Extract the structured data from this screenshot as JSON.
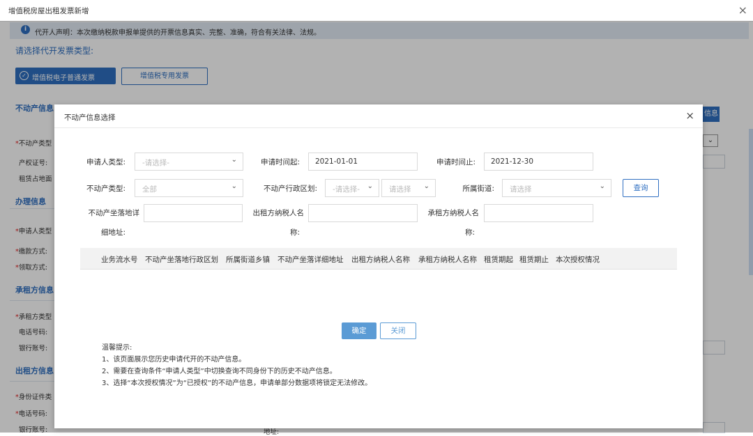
{
  "page": {
    "title": "增值税房屋出租发票新增",
    "close_symbol": "×",
    "notice_text": "代开人声明：本次缴纳税款申报单提供的开票信息真实、完整、准确，符合有关法律、法规。",
    "choose_label": "请选择代开发票类型:",
    "btn_ordinary": "增值税电子普通发票",
    "btn_special": "增值税专用发票",
    "sections": {
      "realestate": "不动产信息",
      "handling": "办理信息",
      "lessee": "承租方信息",
      "lessor": "出租方信息"
    },
    "right_btn": "信息",
    "bg_labels": {
      "estate_type": "不动产类型",
      "cert_no": "产权证号:",
      "area": "租赁占地面",
      "applicant_type": "申请人类型",
      "pay_method": "缴款方式:",
      "receive_method": "领取方式:",
      "lessee_type": "承租方类型",
      "lessee_phone": "电话号码:",
      "lessee_bank": "银行账号:",
      "id_type": "身份证件类",
      "lessor_phone": "电话号码:",
      "lessor_bank": "银行账号:",
      "address": "地址:"
    }
  },
  "dialog": {
    "title": "不动产信息选择",
    "close_symbol": "×",
    "filters": {
      "applicant_type_label": "申请人类型:",
      "applicant_type_placeholder": "-请选择-",
      "date_start_label": "申请时间起:",
      "date_start_value": "2021-01-01",
      "date_end_label": "申请时间止:",
      "date_end_value": "2021-12-30",
      "estate_type_label": "不动产类型:",
      "estate_type_placeholder": "全部",
      "admin_region_label": "不动产行政区划:",
      "admin_region_placeholder1": "-请选择-",
      "admin_region_placeholder2": "请选择",
      "street_label": "所属街道:",
      "street_placeholder": "请选择",
      "query_button": "查询",
      "address_label_l1": "不动产坐落地详",
      "address_label_l2": "细地址:",
      "lessor_name_label_l1": "出租方纳税人名",
      "lessor_name_label_l2": "称:",
      "lessee_name_label_l1": "承租方纳税人名",
      "lessee_name_label_l2": "称:"
    },
    "table_headers": [
      "业务流水号",
      "不动产坐落地行政区划",
      "所属街道乡镇",
      "不动产坐落详细地址",
      "出租方纳税人名称",
      "承租方纳税人名称",
      "租赁期起",
      "租赁期止",
      "本次授权情况"
    ],
    "confirm_button": "确定",
    "close_button": "关闭",
    "tips_title": "温馨提示:",
    "tips": [
      "1、该页面展示您历史申请代开的不动产信息。",
      "2、需要在查询条件“申请人类型”中切换查询不同身份下的历史不动产信息。",
      "3、选择“本次授权情况”为“已授权”的不动产信息，申请单部分数据项将锁定无法修改。"
    ]
  },
  "icons": {
    "info": "info-icon",
    "check_circle": "check-circle-icon",
    "chevron": "chevron-down-icon"
  },
  "colors": {
    "accent": "#2f6fc1",
    "confirm": "#5b9bd5",
    "required": "#e02020"
  }
}
